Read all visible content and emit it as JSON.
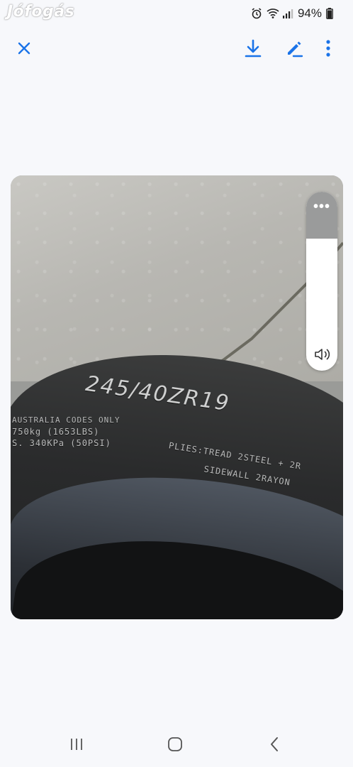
{
  "status_bar": {
    "watermark": "Jófogás",
    "battery": "94%",
    "icons": [
      "alarm-icon",
      "wifi-icon",
      "signal-icon",
      "battery-icon"
    ]
  },
  "top_bar": {
    "icons": [
      "close-icon",
      "download-icon",
      "edit-icon",
      "more-vert-icon"
    ],
    "accent_color": "#1a73e8"
  },
  "photo": {
    "tire_size": "245/40ZR19",
    "tire_line1": "AUSTRALIA CODES ONLY",
    "tire_line2": "750kg (1653LBS)",
    "tire_line3": "S. 340KPa (50PSI)",
    "tire_plies": "PLIES:TREAD 2STEEL + 2R",
    "tire_sidewall": "SIDEWALL 2RAYON"
  },
  "side_panel": {
    "icons": [
      "more-horiz-icon",
      "volume-icon"
    ]
  },
  "nav_bar": {
    "icons": [
      "recents-icon",
      "home-icon",
      "back-icon"
    ]
  }
}
